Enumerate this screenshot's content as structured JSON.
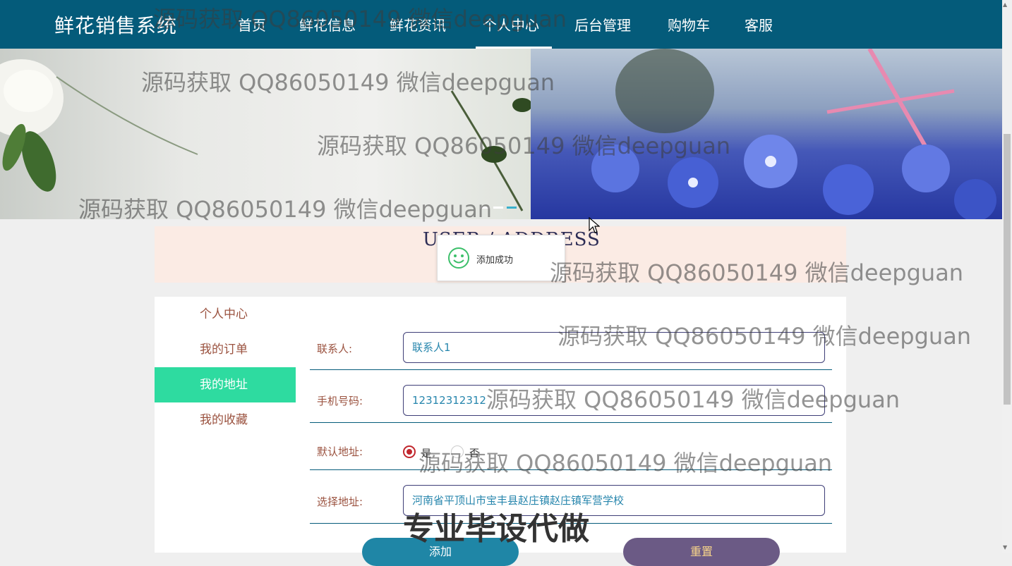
{
  "nav": {
    "brand": "鲜花销售系统",
    "items": [
      "首页",
      "鲜花信息",
      "鲜花资讯",
      "个人中心",
      "后台管理",
      "购物车",
      "客服"
    ],
    "active_index": 3
  },
  "banner": {
    "slide_count": 3,
    "active_slide": 3
  },
  "section_title": "USER / ADDRESS",
  "toast": {
    "icon": "smile-icon",
    "message": "添加成功"
  },
  "sidebar": {
    "items": [
      "个人中心",
      "我的订单",
      "我的地址",
      "我的收藏"
    ],
    "active_index": 2
  },
  "form": {
    "contact_label": "联系人:",
    "contact_value": "联系人1",
    "phone_label": "手机号码:",
    "phone_value": "12312312312",
    "default_label": "默认地址:",
    "default_options": [
      "是",
      "否"
    ],
    "default_selected": "是",
    "address_label": "选择地址:",
    "address_value": "河南省平顶山市宝丰县赵庄镇赵庄镇军营学校",
    "add_button": "添加",
    "reset_button": "重置"
  },
  "watermarks": {
    "text": "源码获取 QQ86050149 微信deepguan",
    "big": "专业毕设代做"
  },
  "colors": {
    "nav_bg": "#045b7a",
    "sidebar_active": "#2edba0",
    "add_button": "#1f86a6",
    "reset_button": "#6b5a85"
  }
}
